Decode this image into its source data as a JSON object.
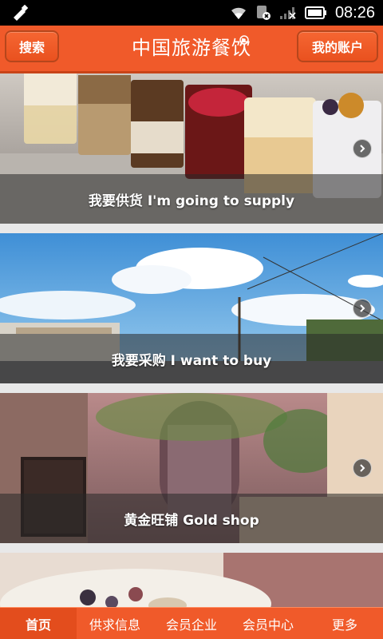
{
  "status_bar": {
    "time": "08:26",
    "icons": [
      "usb-debug-icon",
      "wifi-icon",
      "sim-blocked-icon",
      "signal-icon",
      "battery-icon"
    ]
  },
  "header": {
    "search_label": "搜索",
    "title": "中国旅游餐饮",
    "account_label": "我的账户"
  },
  "feed": {
    "cards": [
      {
        "caption": "我要供货 I'm going to supply",
        "image": "dessert-cups-photo"
      },
      {
        "caption": "我要采购 I want to buy",
        "image": "sky-street-photo"
      },
      {
        "caption": "黄金旺铺 Gold shop",
        "image": "cafe-storefront-photo"
      },
      {
        "caption": "",
        "image": "food-plate-photo"
      }
    ]
  },
  "tabbar": {
    "tabs": [
      {
        "label": "首页",
        "active": true
      },
      {
        "label": "供求信息",
        "active": false
      },
      {
        "label": "会员企业",
        "active": false
      },
      {
        "label": "会员中心",
        "active": false
      },
      {
        "label": "更多",
        "active": false
      }
    ]
  },
  "colors": {
    "brand": "#f05a2a",
    "brand_dark": "#c84418",
    "status_bar": "#000000"
  }
}
